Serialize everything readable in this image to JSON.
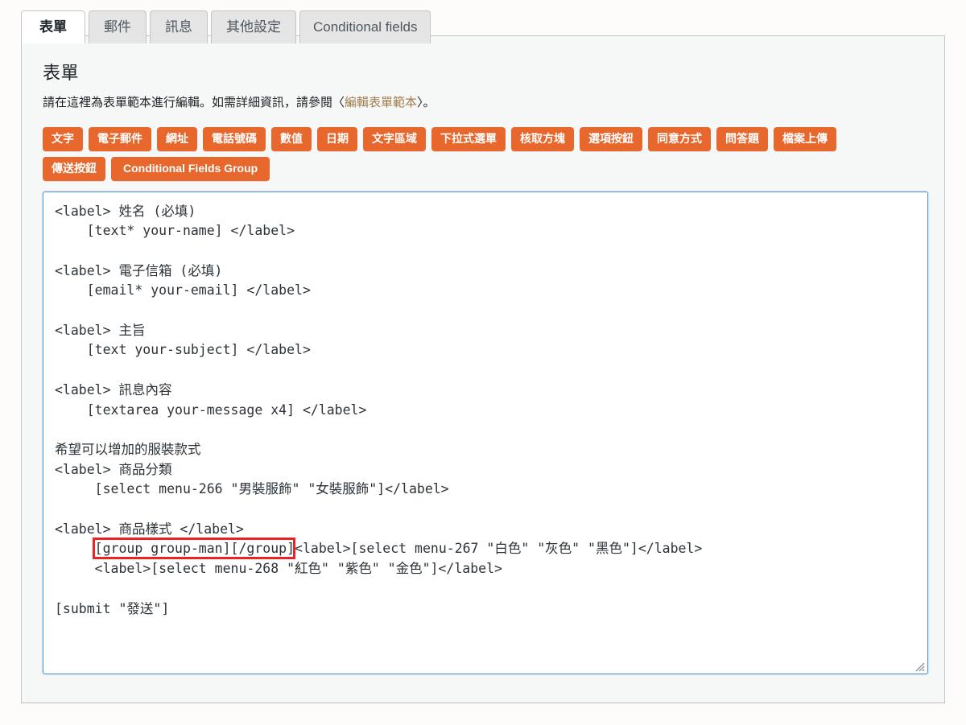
{
  "tabs": [
    {
      "label": "表單",
      "active": true,
      "latin": false
    },
    {
      "label": "郵件",
      "active": false,
      "latin": false
    },
    {
      "label": "訊息",
      "active": false,
      "latin": false
    },
    {
      "label": "其他設定",
      "active": false,
      "latin": false
    },
    {
      "label": "Conditional fields",
      "active": false,
      "latin": true
    }
  ],
  "panel": {
    "title": "表單",
    "description_before": "請在這裡為表單範本進行編輯。如需詳細資訊，請參閱〈",
    "description_link": "編輯表單範本",
    "description_after": "〉。"
  },
  "tag_buttons": {
    "row1": [
      "文字",
      "電子郵件",
      "網址",
      "電話號碼",
      "數值",
      "日期",
      "文字區域",
      "下拉式選單",
      "核取方塊",
      "選項按鈕",
      "同意方式",
      "問答題",
      "檔案上傳"
    ],
    "row2": [
      "傳送按鈕",
      "Conditional Fields Group"
    ]
  },
  "editor": {
    "name": "form-template-textarea",
    "content": "<label> 姓名 (必填)\n    [text* your-name] </label>\n\n<label> 電子信箱 (必填)\n    [email* your-email] </label>\n\n<label> 主旨\n    [text your-subject] </label>\n\n<label> 訊息內容\n    [textarea your-message x4] </label>\n\n希望可以增加的服裝款式\n<label> 商品分類\n     [select menu-266 \"男裝服飾\" \"女裝服飾\"]</label>\n\n<label> 商品樣式 </label>\n     [group group-man][/group]<label>[select menu-267 \"白色\" \"灰色\" \"黑色\"]</label>\n     <label>[select menu-268 \"紅色\" \"紫色\" \"金色\"]</label>\n\n[submit \"發送\"]",
    "highlighted_snippet": "[group group-man][/group]"
  },
  "colors": {
    "tag_button_bg": "#e8672c",
    "tag_button_text": "#ffffff",
    "link": "#a07d4e",
    "annotation_box": "#ee2222",
    "textarea_border": "#4f94d4",
    "panel_bg": "#f6f7f7",
    "active_tab_bg": "#ffffff",
    "inactive_tab_bg": "#e5e5e5"
  },
  "icons": {
    "resize_handle": "resize-handle-icon"
  }
}
